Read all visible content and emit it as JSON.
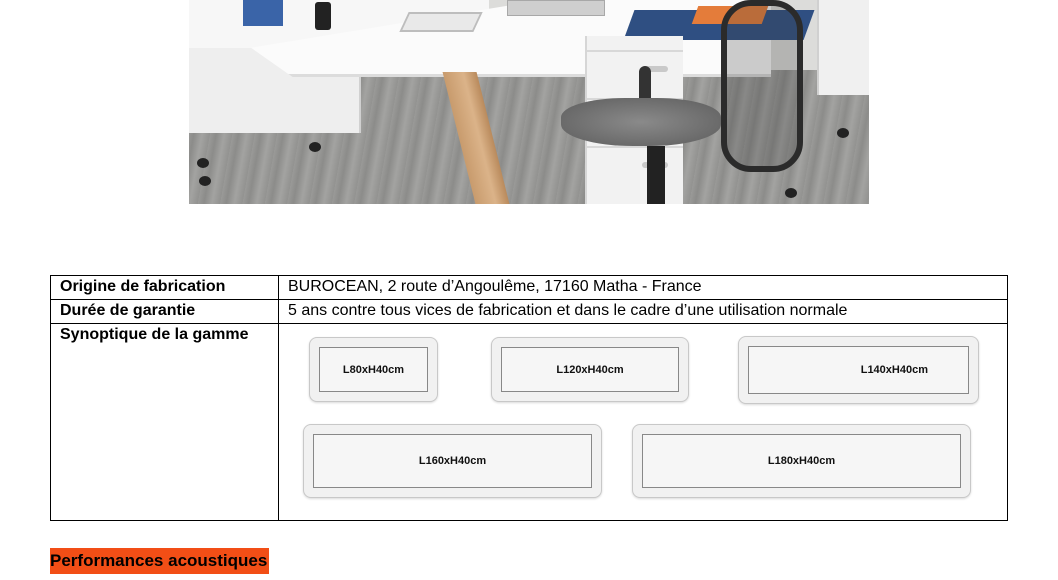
{
  "table": {
    "rows": [
      {
        "label": "Origine de fabrication",
        "value": "BUROCEAN, 2 route d’Angoulême, 17160 Matha - France"
      },
      {
        "label": "Durée de garantie",
        "value": "5 ans contre tous vices de fabrication et dans le cadre d’une utilisation normale"
      },
      {
        "label": "Synoptique de la gamme",
        "value": ""
      }
    ]
  },
  "synoptic": {
    "sizes": [
      "L80xH40cm",
      "L120xH40cm",
      "L140xH40cm",
      "L160xH40cm",
      "L180xH40cm"
    ]
  },
  "section": {
    "title": "Performances acoustiques",
    "highlight_color": "#f24e16"
  }
}
